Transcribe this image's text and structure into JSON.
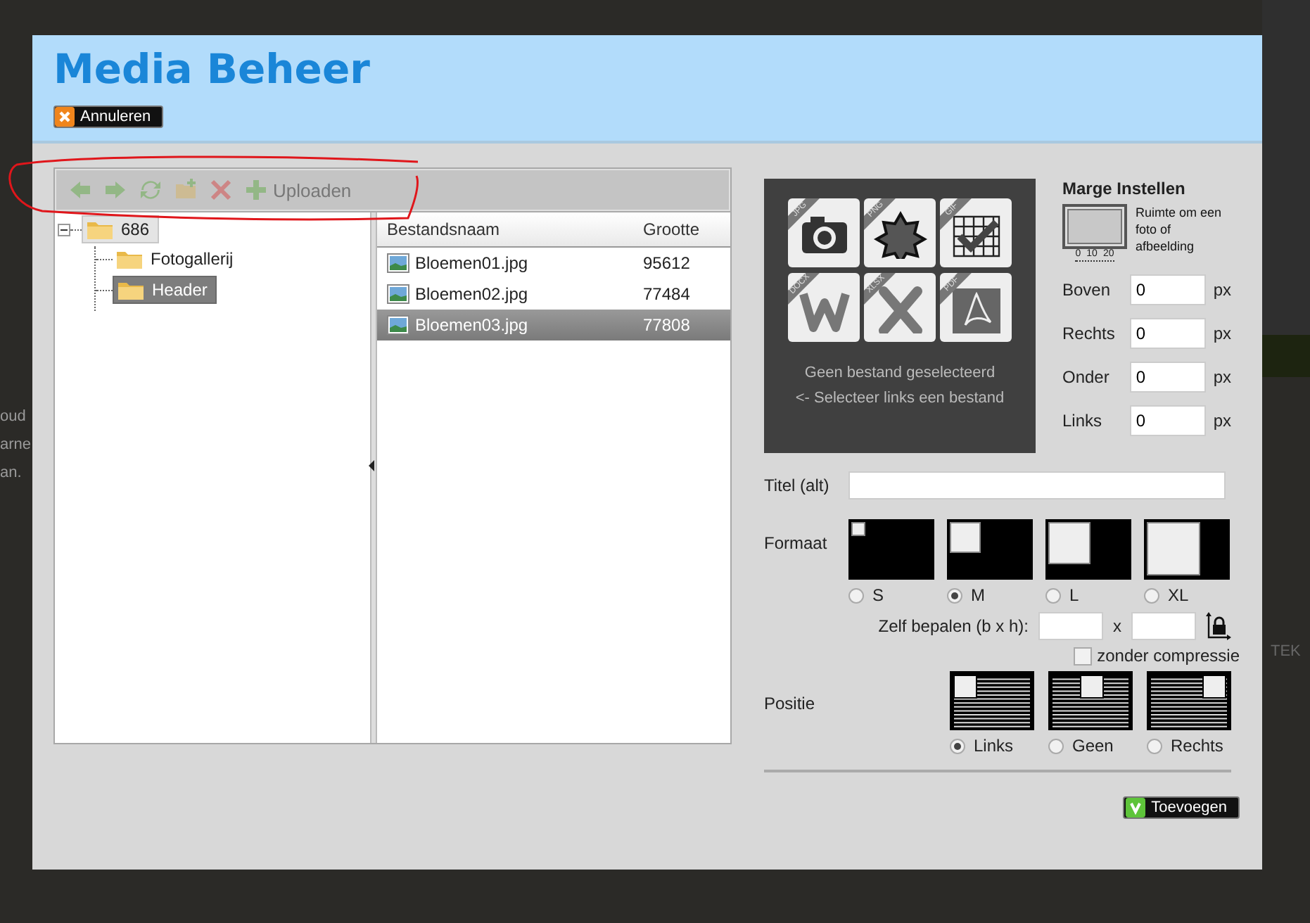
{
  "background_page": {
    "left_texts": [
      "oud",
      "arne",
      "an."
    ],
    "right_tab": "TEK"
  },
  "dialog": {
    "title": "Media Beheer",
    "cancel_button": "Annuleren"
  },
  "toolbar": [
    {
      "kind": "back",
      "disabled": true
    },
    {
      "kind": "forward",
      "disabled": true
    },
    {
      "kind": "refresh",
      "disabled": true
    },
    {
      "kind": "new-folder",
      "disabled": true
    },
    {
      "kind": "delete",
      "disabled": true
    },
    {
      "kind": "upload",
      "label": "Uploaden",
      "disabled": true
    }
  ],
  "folder_tree": [
    {
      "label": "686",
      "selected": false,
      "expanded": true,
      "children": [
        {
          "label": "Fotogallerij",
          "selected": false
        },
        {
          "label": "Header",
          "selected": true
        }
      ]
    }
  ],
  "file_table": {
    "columns": [
      "Bestandsnaam",
      "Grootte"
    ],
    "rows": [
      {
        "name": "Bloemen01.jpg",
        "size": "95612",
        "selected": false
      },
      {
        "name": "Bloemen02.jpg",
        "size": "77484",
        "selected": false
      },
      {
        "name": "Bloemen03.jpg",
        "size": "77808",
        "selected": true
      }
    ]
  },
  "preview": {
    "file_types": [
      "JPG",
      "PNG",
      "GIF",
      "DOCX",
      "XLSX",
      "PDF"
    ],
    "message": "Geen bestand geselecteerd",
    "hint": "<- Selecteer links een bestand"
  },
  "margins": {
    "title": "Marge Instellen",
    "description": "Ruimte om een foto of afbeelding",
    "scale": [
      "0",
      "10",
      "20"
    ],
    "fields": [
      {
        "label": "Boven",
        "value": "0",
        "unit": "px"
      },
      {
        "label": "Rechts",
        "value": "0",
        "unit": "px"
      },
      {
        "label": "Onder",
        "value": "0",
        "unit": "px"
      },
      {
        "label": "Links",
        "value": "0",
        "unit": "px"
      }
    ]
  },
  "title_field": {
    "label": "Titel (alt)"
  },
  "format": {
    "label": "Formaat",
    "options": [
      {
        "label": "S",
        "selected": false
      },
      {
        "label": "M",
        "selected": true
      },
      {
        "label": "L",
        "selected": false
      },
      {
        "label": "XL",
        "selected": false
      }
    ],
    "custom_label": "Zelf bepalen (b x h):",
    "separator": "x",
    "no_compression": {
      "label": "zonder compressie",
      "checked": false
    }
  },
  "position": {
    "label": "Positie",
    "options": [
      {
        "kind": "left",
        "label": "Links",
        "selected": true
      },
      {
        "kind": "center",
        "label": "Geen",
        "selected": false
      },
      {
        "kind": "right",
        "label": "Rechts",
        "selected": false
      }
    ]
  },
  "add_button": "Toevoegen"
}
